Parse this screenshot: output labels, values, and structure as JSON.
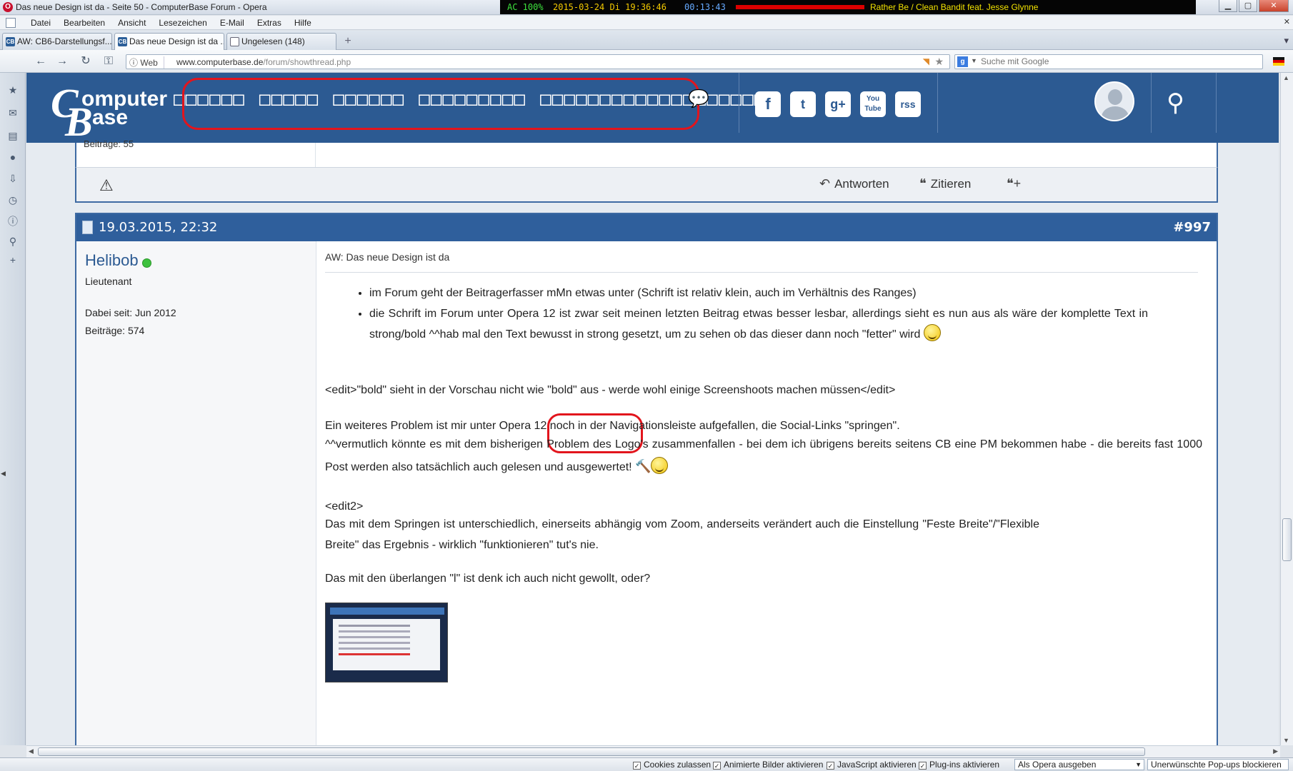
{
  "window": {
    "title": "Das neue Design ist da - Seite 50 - ComputerBase Forum - Opera",
    "os_status": {
      "power": "AC 100%",
      "datetime": "2015-03-24 Di 19:36:46",
      "uptime": "00:13:43",
      "now_playing": "Rather Be / Clean Bandit feat. Jesse Glynne"
    }
  },
  "menubar": {
    "items": [
      "Datei",
      "Bearbeiten",
      "Ansicht",
      "Lesezeichen",
      "E-Mail",
      "Extras",
      "Hilfe"
    ]
  },
  "tabs": [
    {
      "label": "AW: CB6-Darstellungsf...",
      "active": false
    },
    {
      "label": "Das neue Design ist da ...",
      "active": true
    },
    {
      "label": "Ungelesen (148)",
      "active": false
    }
  ],
  "addressbar": {
    "web_badge": "Web",
    "url_domain": "www.computerbase.de",
    "url_path": "/forum/showthread.php",
    "search_placeholder": "Suche mit Google"
  },
  "site_header": {
    "logo_line1": "Computer",
    "logo_line2": "Base",
    "nav_items": [
      "□□□□□□",
      "□□□□□",
      "□□□□□□",
      "□□□□□□□□□",
      "□□□□□□□□□□□□□□□□□□□"
    ],
    "social": [
      "f",
      "t",
      "g+",
      "You Tube",
      "rss"
    ]
  },
  "prev_post": {
    "cut_text": "Beiträge: 55",
    "actions": {
      "reply": "Antworten",
      "quote": "Zitieren"
    }
  },
  "post": {
    "date": "19.03.2015, 22:32",
    "number": "#997",
    "user": {
      "name": "Helibob",
      "rank": "Lieutenant",
      "joined_label": "Dabei seit:",
      "joined_value": "Jun 2012",
      "posts_label": "Beiträge:",
      "posts_value": "574"
    },
    "title": "AW: Das neue Design ist da",
    "bullets": [
      "im Forum geht der Beitragerfasser mMn etwas unter (Schrift ist relativ klein, auch im Verhältnis des Ranges)",
      "die Schrift im Forum unter Opera 12 ist zwar seit meinen letzten Beitrag etwas besser lesbar, allerdings sieht es nun aus als wäre der komplette Text in strong/bold ^^hab mal den Text bewusst in strong gesetzt, um zu sehen ob das dieser dann noch \"fetter\" wird"
    ],
    "para_edit": "<edit>\"bold\" sieht in der Vorschau nicht wie \"bold\" aus - werde wohl einige Screenshoots machen müssen</edit>",
    "para_problem_1": "Ein weiteres Problem ist mir unter Opera 12 noch in der Navigationsleiste aufgefallen, die Social-Links \"springen\".",
    "para_problem_2": "^^vermutlich könnte es mit dem bisherigen Problem des Logo's zusammenfallen - bei dem ich übrigens bereits seitens CB eine PM bekommen habe - die bereits fast 1000 Post werden also tatsächlich auch gelesen und ausgewertet!",
    "edit2_tag": "<edit2>",
    "para_edit2": "Das mit dem Springen ist unterschiedlich, einerseits abhängig vom Zoom, anderseits verändert auch die Einstellung \"Feste Breite\"/\"Flexible Breite\" das Ergebnis - wirklich \"funktionieren\" tut's nie.",
    "para_question": "Das mit den überlangen \"l\" ist denk ich auch nicht gewollt, oder?"
  },
  "statusbar": {
    "cookies": "Cookies zulassen",
    "anim": "Animierte Bilder aktivieren",
    "js": "JavaScript aktivieren",
    "plugins": "Plug-ins aktivieren",
    "ua": "Als Opera ausgeben",
    "popups": "Unerwünschte Pop-ups blockieren"
  },
  "colors": {
    "header_blue": "#2c5a92",
    "post_header_blue": "#2f5f9c",
    "annotation_red": "#e2151d",
    "online_green": "#3ec13e"
  }
}
